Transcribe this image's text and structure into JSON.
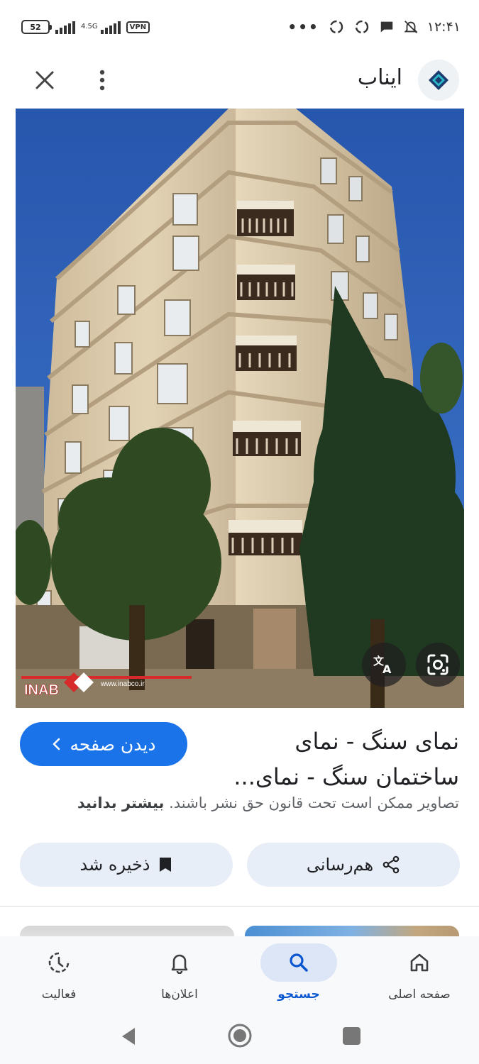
{
  "status_bar": {
    "battery": "52",
    "network": "4.5G",
    "vpn": "VPN",
    "dots": "•••",
    "time": "۱۲:۴۱"
  },
  "header": {
    "site_name": "ایناب",
    "close_icon": "close-icon",
    "more_icon": "more-vert-icon"
  },
  "image": {
    "watermark_brand": "INAB",
    "watermark_url": "www.inabco.ir",
    "translate_icon": "translate-icon",
    "lens_icon": "google-lens-icon"
  },
  "result": {
    "title_line1": "نمای سنگ - نمای",
    "title_line2": "ساختمان سنگ - نمای...",
    "visit_label": "دیدن صفحه",
    "copyright_text": "تصاویر ممکن است تحت قانون حق نشر باشند.",
    "learn_more": "بیشتر بدانید"
  },
  "actions": {
    "share_label": "هم‌رسانی",
    "save_label": "ذخیره شد"
  },
  "bottom_nav": {
    "home": "صفحه اصلی",
    "search": "جستجو",
    "notifications": "اعلان‌ها",
    "activity": "فعالیت"
  },
  "colors": {
    "accent": "#1a73e8",
    "active_nav": "#0b57d0",
    "pill_bg": "#e8eef7",
    "sky": "#2f63b9"
  }
}
